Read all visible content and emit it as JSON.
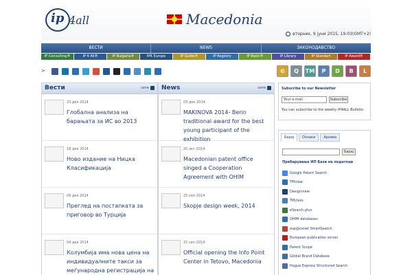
{
  "header": {
    "logo_ip": "ip",
    "logo_4all": "4all",
    "country": "Macedonia",
    "datetime": "вторник, 9 јуни 2015, 19:03(GMT+2)"
  },
  "main_nav": [
    "ВЕСТИ",
    "NEWS",
    "ЗАКОНОДАВСТВО"
  ],
  "sub_nav": [
    {
      "label": "IP Consulting®",
      "color": "#2f7d3e"
    },
    {
      "label": "IP 4 All®",
      "color": "#2d5a91"
    },
    {
      "label": "IP Bulgaria®",
      "color": "#6f8b3b"
    },
    {
      "label": "IPR Europe",
      "color": "#26527d"
    },
    {
      "label": "IP Guide®",
      "color": "#b4952a"
    },
    {
      "label": "IP Registry",
      "color": "#2e6fa8"
    },
    {
      "label": "IP Basic®",
      "color": "#6a9a32"
    },
    {
      "label": "IP Library",
      "color": "#4f4f9c"
    },
    {
      "label": "IP Standart",
      "color": "#b07a2e"
    },
    {
      "label": "IP Award®",
      "color": "#b12727"
    }
  ],
  "share_icons": [
    {
      "name": "facebook-icon",
      "color": "#3b5998"
    },
    {
      "name": "linkedin-icon",
      "color": "#0e76a8"
    },
    {
      "name": "email-icon",
      "color": "#2a6fb8"
    },
    {
      "name": "twitter-icon",
      "color": "#2fa3d6"
    },
    {
      "name": "google-plus-icon",
      "color": "#dd4b39"
    },
    {
      "name": "digg-icon",
      "color": "#1b5a95"
    },
    {
      "name": "delicious-icon",
      "color": "#222222"
    },
    {
      "name": "myspace-icon",
      "color": "#2a6fb8"
    },
    {
      "name": "reddit-icon",
      "color": "#4d8fcc"
    },
    {
      "name": "print-icon",
      "color": "#2a8cb8"
    },
    {
      "name": "share-icon",
      "color": "#2a6fb8"
    }
  ],
  "tool_icons": [
    {
      "name": "copyright-icon",
      "symbol": "©",
      "color": "#d5a331"
    },
    {
      "name": "search-icon",
      "symbol": "Q",
      "color": "#7e8e9a"
    },
    {
      "name": "trademark-icon",
      "symbol": "TM",
      "color": "#4b9a9a"
    },
    {
      "name": "patent-icon",
      "symbol": "P",
      "color": "#5b7fb1"
    },
    {
      "name": "design-icon",
      "symbol": "D",
      "color": "#6ea640"
    },
    {
      "name": "book-icon",
      "symbol": "B",
      "color": "#9f4f6f"
    },
    {
      "name": "law-icon",
      "symbol": "L",
      "color": "#cc7d3a"
    }
  ],
  "news_mk": {
    "title": "Вести",
    "all": "сите",
    "items": [
      {
        "date": "23 дек 2014",
        "title": "Глобална анализа на барањата за ИС во 2013"
      },
      {
        "date": "19 дек 2014",
        "title": "Ново издание на Ницка Класификација"
      },
      {
        "date": "09 дек 2014",
        "title": "Преглед на постапката за приговор во Турција"
      },
      {
        "date": "04 дек 2014",
        "title": "Колумбија има нова цена на индивидуалните такси за меѓународна регистрација на ТМ"
      }
    ]
  },
  "news_en": {
    "title": "News",
    "all": "сите",
    "items": [
      {
        "date": "03 дек 2014",
        "title": "MAKINOVA 2014- Berin traditional award for the best young participant of the exhibition"
      },
      {
        "date": "20 окт 2014",
        "title": "Macedonian patent office singed a Cooperation Agreement with OHIM"
      },
      {
        "date": "25 сеп 2014",
        "title": "Skopje design week, 2014"
      },
      {
        "date": "15 сеп 2014",
        "title": "Official opening the Info Point Center in Tetovo, Macedonia"
      }
    ]
  },
  "newsletter": {
    "title": "Subscribe to our Newsletter",
    "input_value": "Your e-mail",
    "button": "Subscribe",
    "text": "You can subscribe to the weekly IP4ALL Bulletin."
  },
  "databases": {
    "tabs": [
      "Барај",
      "Ознаки",
      "Архива"
    ],
    "search_button": "Барај",
    "title": "Пребарување ИП Бази на податоци",
    "items": [
      {
        "label": "Google Patent Search",
        "color": "#4285f4"
      },
      {
        "label": "TMview",
        "color": "#2a6fb8"
      },
      {
        "label": "Designview",
        "color": "#1f3f78"
      },
      {
        "label": "TMclass",
        "color": "#4a7fb8"
      },
      {
        "label": "eSearch plus",
        "color": "#3c7a3c"
      },
      {
        "label": "OHIM databases",
        "color": "#2a6fb8"
      },
      {
        "label": "esp@cenet SmartSearch",
        "color": "#c04040"
      },
      {
        "label": "European publication server",
        "color": "#b02020"
      },
      {
        "label": "Patent Scope",
        "color": "#2a6fb8"
      },
      {
        "label": "Global Brand Database",
        "color": "#3d6fa0"
      },
      {
        "label": "Hague Express Structured Search",
        "color": "#4a6fa0"
      }
    ]
  }
}
